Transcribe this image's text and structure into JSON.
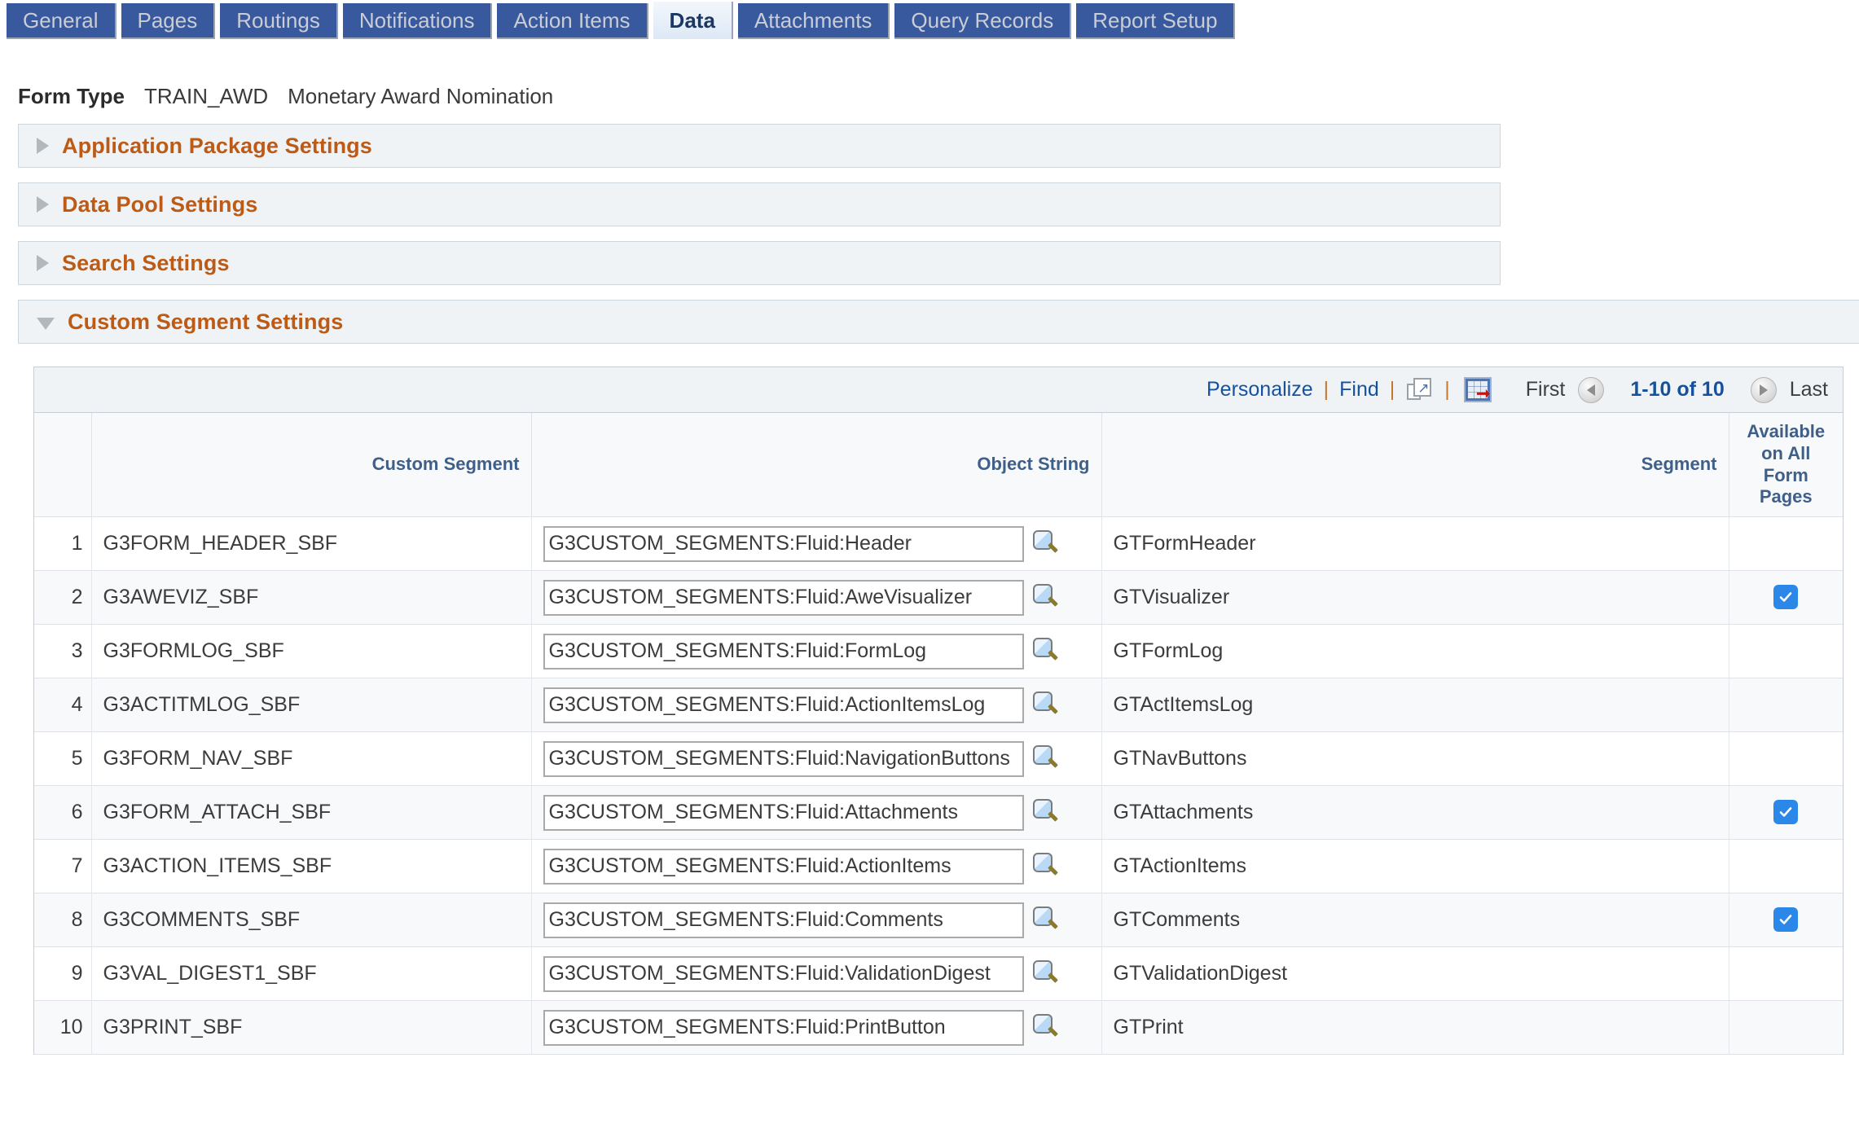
{
  "tabs": [
    {
      "label": "General",
      "active": false
    },
    {
      "label": "Pages",
      "active": false
    },
    {
      "label": "Routings",
      "active": false
    },
    {
      "label": "Notifications",
      "active": false
    },
    {
      "label": "Action Items",
      "active": false
    },
    {
      "label": "Data",
      "active": true
    },
    {
      "label": "Attachments",
      "active": false
    },
    {
      "label": "Query Records",
      "active": false
    },
    {
      "label": "Report Setup",
      "active": false
    }
  ],
  "form_type": {
    "label": "Form Type",
    "code": "TRAIN_AWD",
    "description": "Monetary Award Nomination"
  },
  "sections": [
    {
      "title": "Application Package Settings",
      "expanded": false
    },
    {
      "title": "Data Pool Settings",
      "expanded": false
    },
    {
      "title": "Search Settings",
      "expanded": false
    },
    {
      "title": "Custom Segment Settings",
      "expanded": true
    }
  ],
  "grid": {
    "toolbar": {
      "personalize_label": "Personalize",
      "find_label": "Find",
      "separator": "|",
      "new_window_icon": "new-window-icon",
      "download_icon": "spreadsheet-download-icon"
    },
    "pager": {
      "first_label": "First",
      "last_label": "Last",
      "range_label": "1-10 of 10",
      "prev_icon": "left-arrow-icon",
      "next_icon": "right-arrow-icon"
    },
    "columns": {
      "row_number": "",
      "custom_segment": "Custom Segment",
      "object_string": "Object String",
      "segment": "Segment",
      "available_on_all_form_pages": "Available on All Form Pages"
    },
    "rows": [
      {
        "num": "1",
        "custom_segment": "G3FORM_HEADER_SBF",
        "object_string": "G3CUSTOM_SEGMENTS:Fluid:Header",
        "segment": "GTFormHeader",
        "available": false
      },
      {
        "num": "2",
        "custom_segment": "G3AWEVIZ_SBF",
        "object_string": "G3CUSTOM_SEGMENTS:Fluid:AweVisualizer",
        "segment": "GTVisualizer",
        "available": true
      },
      {
        "num": "3",
        "custom_segment": "G3FORMLOG_SBF",
        "object_string": "G3CUSTOM_SEGMENTS:Fluid:FormLog",
        "segment": "GTFormLog",
        "available": false
      },
      {
        "num": "4",
        "custom_segment": "G3ACTITMLOG_SBF",
        "object_string": "G3CUSTOM_SEGMENTS:Fluid:ActionItemsLog",
        "segment": "GTActItemsLog",
        "available": false
      },
      {
        "num": "5",
        "custom_segment": "G3FORM_NAV_SBF",
        "object_string": "G3CUSTOM_SEGMENTS:Fluid:NavigationButtons",
        "segment": "GTNavButtons",
        "available": false
      },
      {
        "num": "6",
        "custom_segment": "G3FORM_ATTACH_SBF",
        "object_string": "G3CUSTOM_SEGMENTS:Fluid:Attachments",
        "segment": "GTAttachments",
        "available": true
      },
      {
        "num": "7",
        "custom_segment": "G3ACTION_ITEMS_SBF",
        "object_string": "G3CUSTOM_SEGMENTS:Fluid:ActionItems",
        "segment": "GTActionItems",
        "available": false
      },
      {
        "num": "8",
        "custom_segment": "G3COMMENTS_SBF",
        "object_string": "G3CUSTOM_SEGMENTS:Fluid:Comments",
        "segment": "GTComments",
        "available": true
      },
      {
        "num": "9",
        "custom_segment": "G3VAL_DIGEST1_SBF",
        "object_string": "G3CUSTOM_SEGMENTS:Fluid:ValidationDigest",
        "segment": "GTValidationDigest",
        "available": false
      },
      {
        "num": "10",
        "custom_segment": "G3PRINT_SBF",
        "object_string": "G3CUSTOM_SEGMENTS:Fluid:PrintButton",
        "segment": "GTPrint",
        "available": false
      }
    ]
  },
  "colors": {
    "tab_blue": "#39599f",
    "section_orange": "#bd5b16",
    "link_blue": "#16519e",
    "header_blue": "#3f5f88",
    "checkbox_blue": "#2b87e8"
  }
}
